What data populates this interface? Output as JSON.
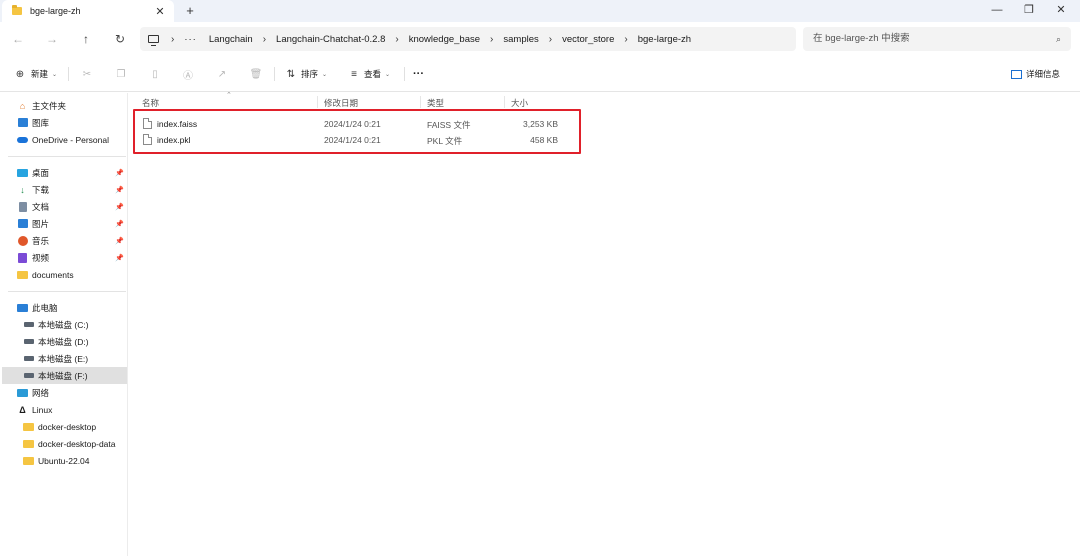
{
  "window": {
    "tab_title": "bge-large-zh",
    "close_glyph": "✕",
    "new_tab_glyph": "+",
    "minimize_glyph": "—",
    "maximize_glyph": "❐",
    "window_close_glyph": "✕"
  },
  "address": {
    "crumbs": [
      "Langchain",
      "Langchain-Chatchat-0.2.8",
      "knowledge_base",
      "samples",
      "vector_store",
      "bge-large-zh"
    ],
    "ellipsis": "···",
    "search_placeholder": "在 bge-large-zh 中搜索"
  },
  "toolbar": {
    "new_label": "新建",
    "sort_label": "排序",
    "view_label": "查看",
    "more_glyph": "···",
    "details_label": "详细信息"
  },
  "sidebar": {
    "quick": [
      {
        "label": "主文件夹",
        "icon": "home-icon"
      },
      {
        "label": "图库",
        "icon": "gallery-icon"
      },
      {
        "label": "OneDrive - Personal",
        "icon": "cloud-icon"
      }
    ],
    "pinned": [
      {
        "label": "桌面",
        "icon": "desktop-icon"
      },
      {
        "label": "下载",
        "icon": "download-icon"
      },
      {
        "label": "文档",
        "icon": "document-icon"
      },
      {
        "label": "图片",
        "icon": "pictures-icon"
      },
      {
        "label": "音乐",
        "icon": "music-icon"
      },
      {
        "label": "视频",
        "icon": "video-icon"
      },
      {
        "label": "documents",
        "icon": "folder-icon"
      }
    ],
    "this_pc": "此电脑",
    "drives": [
      "本地磁盘 (C:)",
      "本地磁盘 (D:)",
      "本地磁盘 (E:)",
      "本地磁盘 (F:)"
    ],
    "network": "网络",
    "linux": "Linux",
    "linux_items": [
      "docker-desktop",
      "docker-desktop-data",
      "Ubuntu-22.04"
    ]
  },
  "columns": {
    "name": "名称",
    "modified": "修改日期",
    "type": "类型",
    "size": "大小"
  },
  "files": [
    {
      "name": "index.faiss",
      "modified": "2024/1/24 0:21",
      "type": "FAISS 文件",
      "size": "3,253 KB"
    },
    {
      "name": "index.pkl",
      "modified": "2024/1/24 0:21",
      "type": "PKL 文件",
      "size": "458 KB"
    }
  ],
  "colors": {
    "highlight_box": "#e0202a",
    "selected_nav": "#e0e0e0",
    "titlebar_bg": "#eef2f9"
  }
}
